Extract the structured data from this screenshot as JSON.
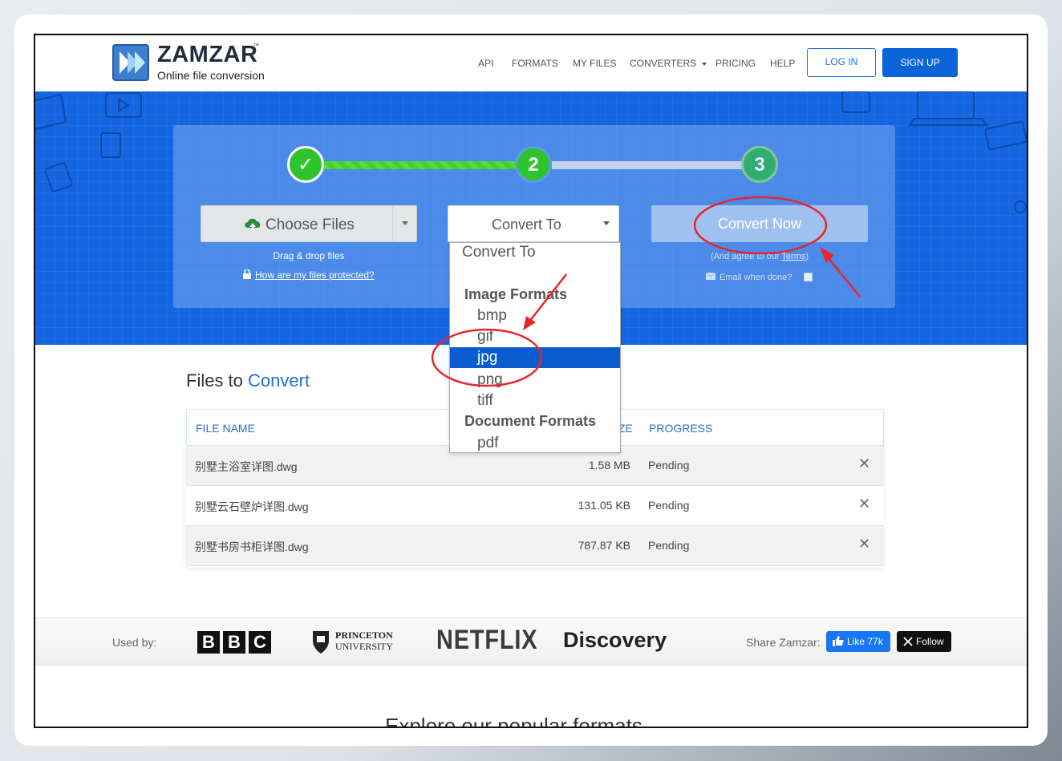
{
  "brand": {
    "name": "ZAMZAR",
    "tm": "™",
    "tagline": "Online file conversion"
  },
  "nav": {
    "items": [
      "API",
      "FORMATS",
      "MY FILES",
      "CONVERTERS",
      "PRICING",
      "HELP"
    ],
    "login": "LOG IN",
    "signup": "SIGN UP"
  },
  "steps": {
    "step1_mark": "✓",
    "step2": "2",
    "step3": "3"
  },
  "upload": {
    "choose_files": "Choose Files",
    "drag_drop": "Drag & drop files",
    "protected_link": "How are my files protected?"
  },
  "convert_to": {
    "label": "Convert To",
    "dropdown": {
      "header": "Convert To",
      "image_group": "Image Formats",
      "image_options": [
        "bmp",
        "gif",
        "jpg",
        "png",
        "tiff"
      ],
      "selected": "jpg",
      "document_group": "Document Formats",
      "document_options": [
        "pdf"
      ]
    }
  },
  "convert_now": {
    "label": "Convert Now",
    "agree_prefix": "(And agree to our ",
    "agree_terms": "Terms",
    "agree_suffix": ")",
    "email_when": "Email when done?"
  },
  "files": {
    "title_plain": "Files to",
    "title_accent": "Convert",
    "columns": {
      "file_name": "FILE NAME",
      "size_partial": "ZE",
      "progress": "PROGRESS"
    },
    "rows": [
      {
        "name": "别墅主浴室详图.dwg",
        "size": "1.58 MB",
        "status": "Pending"
      },
      {
        "name": "别墅云石壁炉详图.dwg",
        "size": "131.05 KB",
        "status": "Pending"
      },
      {
        "name": "别墅书房书柜详图.dwg",
        "size": "787.87 KB",
        "status": "Pending"
      }
    ],
    "remove_glyph": "✕"
  },
  "logos": {
    "used_by": "Used by:",
    "bbc": [
      "B",
      "B",
      "C"
    ],
    "princeton_line1": "PRINCETON",
    "princeton_line2": "UNIVERSITY",
    "netflix": "NETFLIX",
    "discovery": "Discovery",
    "share": "Share Zamzar:",
    "fb_like": "Like 77k",
    "x_follow": "Follow"
  },
  "below_fold": "Explore our popular formats",
  "colors": {
    "brand_blue": "#1565e0",
    "accent_link": "#1e6fd9",
    "step_green": "#2ec42e",
    "selected_option": "#0a5ccf",
    "annotation_red": "#e8262a"
  }
}
